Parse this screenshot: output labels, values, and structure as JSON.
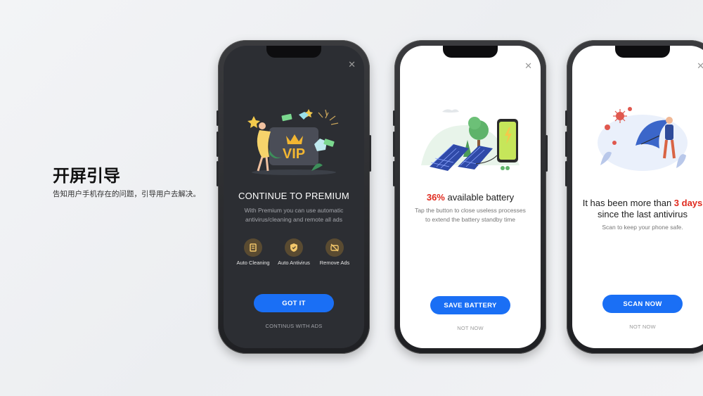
{
  "intro": {
    "title": "开屏引导",
    "subtitle": "告知用户手机存在的问题，引导用户去解决。"
  },
  "colors": {
    "accent": "#1a6ff5",
    "highlight": "#e02a1e",
    "dark_screen": "#2c2e33"
  },
  "screens": [
    {
      "theme": "dark",
      "close_icon": "close-icon",
      "title": "CONTINUE TO PREMIUM",
      "description": "With Premium you can use automatic antivirus/cleaning and remote all ads",
      "vip_badge": "VIP",
      "features": [
        {
          "icon": "broom-icon",
          "label": "Auto Cleaning"
        },
        {
          "icon": "shield-icon",
          "label": "Auto Antivirus"
        },
        {
          "icon": "no-ads-icon",
          "label": "Remove Ads"
        }
      ],
      "primary_button": "GOT IT",
      "secondary_link": "CONTINUS WITH ADS"
    },
    {
      "theme": "light",
      "close_icon": "close-icon",
      "title_highlight": "36%",
      "title_rest": " available battery",
      "description": "Tap the button to close useless processes to extend the battery standby time",
      "primary_button": "SAVE BATTERY",
      "secondary_link": "NOT NOW"
    },
    {
      "theme": "light",
      "close_icon": "close-icon",
      "title_before": "It has been more than ",
      "title_highlight": "3 days",
      "title_after": " since the last antivirus",
      "description": "Scan to keep your phone safe.",
      "primary_button": "SCAN NOW",
      "secondary_link": "NOT NOW"
    }
  ]
}
